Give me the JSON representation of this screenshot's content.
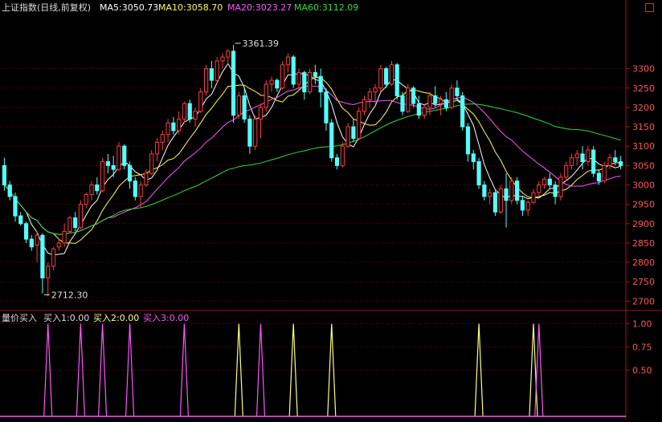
{
  "header": {
    "title": "上证指数(日线,前复权)",
    "ma5": "MA5:3050.73",
    "ma10": "MA10:3058.70",
    "ma20": "MA20:3023.27",
    "ma60": "MA60:3112.09"
  },
  "indicator_header": {
    "name": "量价买入",
    "buy1": "买入1:0.00",
    "buy2": "买入2:0.00",
    "buy3": "买入3:0.00"
  },
  "colors": {
    "up": "#ff3b3b",
    "down": "#54ffff",
    "ma5": "#ffffff",
    "ma10": "#ffff55",
    "ma20": "#ff55ff",
    "ma60": "#33dd33",
    "grid": "#7a0000",
    "axis": "#b01010",
    "buy_yellow": "#ffff80",
    "buy_magenta": "#ff55ff"
  },
  "chart_data": [
    {
      "type": "candlestick",
      "series_name": "上证指数",
      "ylim": [
        2680,
        3440
      ],
      "yticks": [
        2700,
        2750,
        2800,
        2850,
        2900,
        2950,
        3000,
        3050,
        3100,
        3150,
        3200,
        3250,
        3300
      ],
      "annotations": [
        {
          "label": "3361.39",
          "index": 42,
          "value": 3361.39
        },
        {
          "label": "2712.30",
          "index": 7,
          "value": 2712.3
        }
      ],
      "ohlc": [
        [
          3050,
          3070,
          2985,
          3000
        ],
        [
          3000,
          3010,
          2960,
          2970
        ],
        [
          2970,
          2980,
          2905,
          2920
        ],
        [
          2920,
          2930,
          2895,
          2900
        ],
        [
          2900,
          2905,
          2850,
          2860
        ],
        [
          2860,
          2870,
          2830,
          2840
        ],
        [
          2845,
          2880,
          2800,
          2870
        ],
        [
          2870,
          2875,
          2720,
          2760
        ],
        [
          2760,
          2800,
          2712.3,
          2790
        ],
        [
          2790,
          2840,
          2780,
          2835
        ],
        [
          2840,
          2860,
          2830,
          2850
        ],
        [
          2850,
          2900,
          2840,
          2880
        ],
        [
          2880,
          2920,
          2875,
          2915
        ],
        [
          2915,
          2930,
          2880,
          2890
        ],
        [
          2890,
          2960,
          2885,
          2950
        ],
        [
          2950,
          2980,
          2940,
          2975
        ],
        [
          2975,
          3010,
          2960,
          3000
        ],
        [
          3000,
          3020,
          2975,
          2985
        ],
        [
          2985,
          3070,
          2980,
          3060
        ],
        [
          3060,
          3080,
          3030,
          3050
        ],
        [
          3050,
          3075,
          3020,
          3040
        ],
        [
          3040,
          3110,
          3035,
          3100
        ],
        [
          3100,
          3105,
          3040,
          3050
        ],
        [
          3050,
          3060,
          2990,
          3010
        ],
        [
          3010,
          3020,
          2960,
          2970
        ],
        [
          2970,
          3010,
          2940,
          3000
        ],
        [
          3000,
          3040,
          2995,
          3030
        ],
        [
          3030,
          3090,
          3025,
          3080
        ],
        [
          3080,
          3120,
          3060,
          3110
        ],
        [
          3110,
          3140,
          3090,
          3130
        ],
        [
          3130,
          3170,
          3110,
          3160
        ],
        [
          3160,
          3175,
          3130,
          3140
        ],
        [
          3140,
          3190,
          3130,
          3170
        ],
        [
          3170,
          3215,
          3160,
          3210
        ],
        [
          3210,
          3220,
          3160,
          3170
        ],
        [
          3170,
          3200,
          3150,
          3190
        ],
        [
          3190,
          3250,
          3185,
          3240
        ],
        [
          3240,
          3310,
          3230,
          3300
        ],
        [
          3300,
          3320,
          3250,
          3270
        ],
        [
          3270,
          3330,
          3260,
          3320
        ],
        [
          3320,
          3340,
          3300,
          3330
        ],
        [
          3330,
          3350,
          3310,
          3345
        ],
        [
          3345,
          3361.39,
          3160,
          3180
        ],
        [
          3180,
          3240,
          3170,
          3230
        ],
        [
          3230,
          3250,
          3160,
          3170
        ],
        [
          3170,
          3180,
          3080,
          3100
        ],
        [
          3100,
          3180,
          3090,
          3170
        ],
        [
          3170,
          3210,
          3120,
          3200
        ],
        [
          3200,
          3270,
          3190,
          3260
        ],
        [
          3260,
          3280,
          3240,
          3270
        ],
        [
          3270,
          3275,
          3240,
          3250
        ],
        [
          3250,
          3320,
          3245,
          3310
        ],
        [
          3310,
          3340,
          3290,
          3330
        ],
        [
          3330,
          3335,
          3250,
          3260
        ],
        [
          3260,
          3300,
          3245,
          3290
        ],
        [
          3290,
          3295,
          3220,
          3240
        ],
        [
          3240,
          3300,
          3235,
          3290
        ],
        [
          3290,
          3310,
          3260,
          3280
        ],
        [
          3280,
          3300,
          3200,
          3240
        ],
        [
          3240,
          3250,
          3140,
          3160
        ],
        [
          3160,
          3170,
          3060,
          3070
        ],
        [
          3070,
          3080,
          3040,
          3050
        ],
        [
          3050,
          3110,
          3045,
          3100
        ],
        [
          3100,
          3160,
          3095,
          3150
        ],
        [
          3150,
          3170,
          3110,
          3120
        ],
        [
          3120,
          3200,
          3115,
          3190
        ],
        [
          3190,
          3230,
          3180,
          3220
        ],
        [
          3220,
          3250,
          3200,
          3240
        ],
        [
          3240,
          3260,
          3210,
          3250
        ],
        [
          3250,
          3310,
          3240,
          3300
        ],
        [
          3300,
          3305,
          3250,
          3260
        ],
        [
          3260,
          3320,
          3255,
          3310
        ],
        [
          3310,
          3315,
          3220,
          3230
        ],
        [
          3230,
          3240,
          3180,
          3190
        ],
        [
          3190,
          3260,
          3185,
          3250
        ],
        [
          3250,
          3255,
          3200,
          3210
        ],
        [
          3210,
          3230,
          3170,
          3180
        ],
        [
          3180,
          3210,
          3170,
          3200
        ],
        [
          3200,
          3240,
          3180,
          3230
        ],
        [
          3230,
          3255,
          3200,
          3210
        ],
        [
          3210,
          3230,
          3180,
          3220
        ],
        [
          3220,
          3240,
          3190,
          3200
        ],
        [
          3200,
          3260,
          3195,
          3250
        ],
        [
          3250,
          3270,
          3220,
          3230
        ],
        [
          3230,
          3240,
          3140,
          3150
        ],
        [
          3150,
          3160,
          3060,
          3080
        ],
        [
          3080,
          3090,
          3040,
          3060
        ],
        [
          3060,
          3070,
          2990,
          3000
        ],
        [
          3000,
          3010,
          2960,
          2970
        ],
        [
          2970,
          2990,
          2950,
          2980
        ],
        [
          2980,
          2990,
          2920,
          2930
        ],
        [
          2930,
          3000,
          2925,
          2990
        ],
        [
          2990,
          3030,
          2890,
          2960
        ],
        [
          2960,
          3020,
          2950,
          3010
        ],
        [
          3010,
          3020,
          2950,
          2960
        ],
        [
          2960,
          2970,
          2920,
          2935
        ],
        [
          2935,
          2960,
          2920,
          2955
        ],
        [
          2955,
          2990,
          2950,
          2980
        ],
        [
          2980,
          3010,
          2970,
          3000
        ],
        [
          3000,
          3020,
          2990,
          3015
        ],
        [
          3015,
          3030,
          2990,
          3000
        ],
        [
          3000,
          3010,
          2950,
          2970
        ],
        [
          2970,
          3030,
          2960,
          3020
        ],
        [
          3020,
          3060,
          3010,
          3050
        ],
        [
          3050,
          3080,
          3040,
          3070
        ],
        [
          3070,
          3090,
          3050,
          3080
        ],
        [
          3080,
          3100,
          3040,
          3060
        ],
        [
          3060,
          3100,
          3050,
          3090
        ],
        [
          3090,
          3100,
          3020,
          3030
        ],
        [
          3030,
          3040,
          3000,
          3010
        ],
        [
          3010,
          3060,
          3005,
          3050
        ],
        [
          3050,
          3080,
          3040,
          3070
        ],
        [
          3070,
          3090,
          3050,
          3060
        ],
        [
          3060,
          3075,
          3040,
          3050
        ]
      ]
    },
    {
      "type": "bar",
      "series_name": "量价买入",
      "ylim": [
        0,
        1.1
      ],
      "yticks": [
        0.5,
        0.75,
        1.0
      ],
      "signals": [
        {
          "index": 8,
          "value": 1.0,
          "series": "buy_magenta"
        },
        {
          "index": 14,
          "value": 1.0,
          "series": "buy_magenta"
        },
        {
          "index": 18,
          "value": 1.0,
          "series": "buy_magenta"
        },
        {
          "index": 23,
          "value": 1.0,
          "series": "buy_magenta"
        },
        {
          "index": 33,
          "value": 1.0,
          "series": "buy_magenta"
        },
        {
          "index": 43,
          "value": 1.0,
          "series": "buy_yellow"
        },
        {
          "index": 47,
          "value": 1.0,
          "series": "buy_magenta"
        },
        {
          "index": 53,
          "value": 1.0,
          "series": "buy_yellow"
        },
        {
          "index": 60,
          "value": 1.0,
          "series": "buy_yellow"
        },
        {
          "index": 87,
          "value": 1.0,
          "series": "buy_yellow"
        },
        {
          "index": 97,
          "value": 1.0,
          "series": "buy_yellow"
        },
        {
          "index": 98,
          "value": 1.0,
          "series": "buy_magenta"
        }
      ]
    }
  ]
}
